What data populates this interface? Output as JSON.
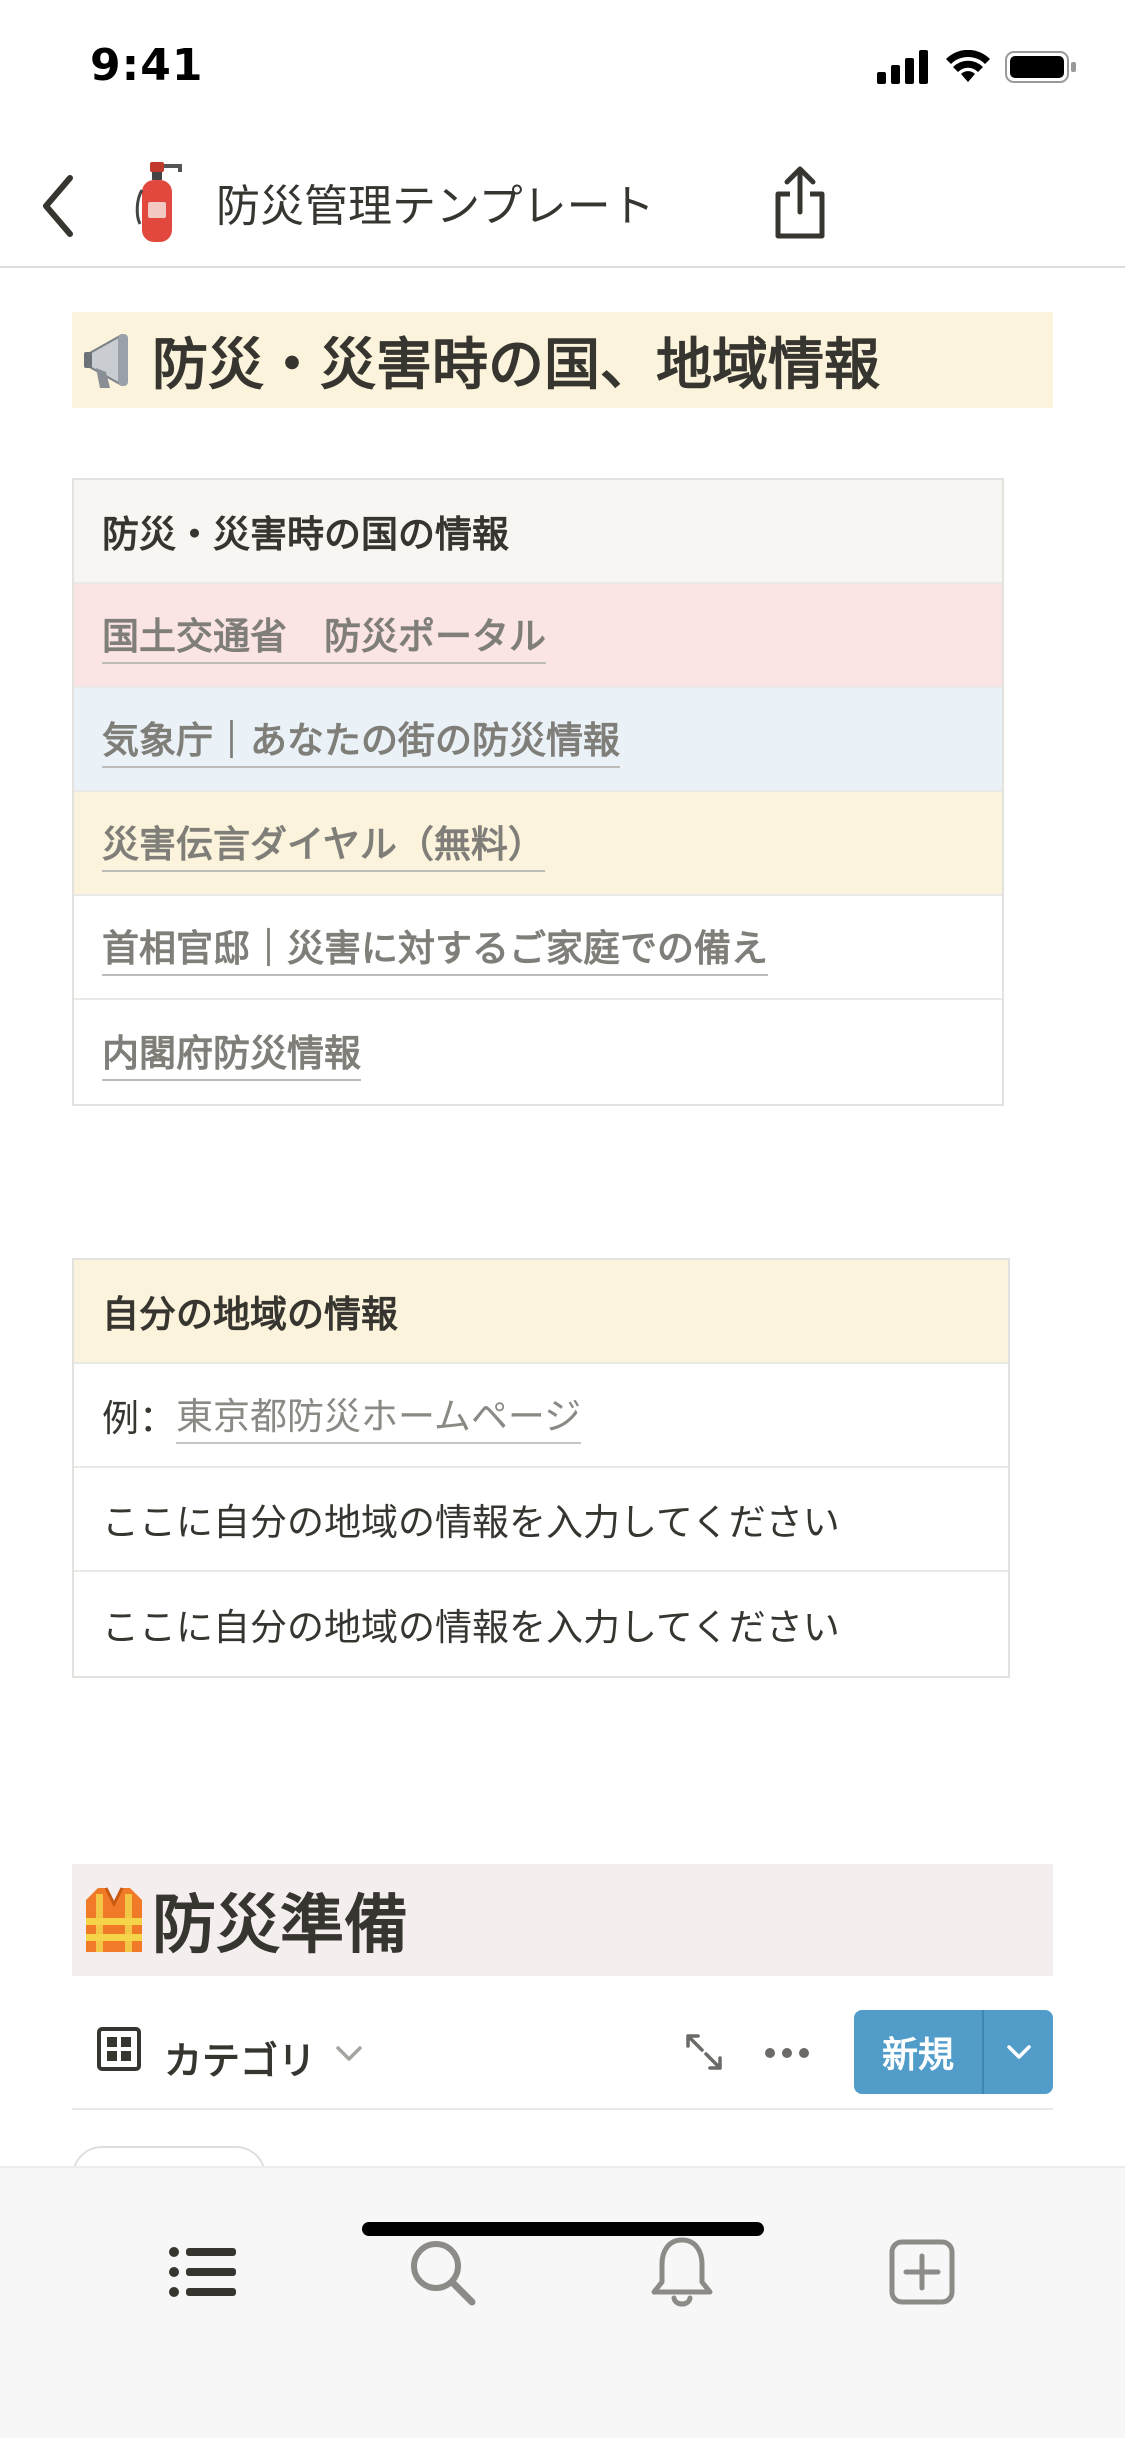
{
  "status_bar": {
    "time": "9:41"
  },
  "nav": {
    "title": "防災管理テンプレート"
  },
  "section1": {
    "heading": "防災・災害時の国、地域情報",
    "national_table": {
      "header": "防災・災害時の国の情報",
      "rows": [
        {
          "label": "国土交通省　防災ポータル",
          "color": "#fbe4e4"
        },
        {
          "label": "気象庁｜あなたの街の防災情報",
          "color": "#eaf2f8"
        },
        {
          "label": "災害伝言ダイヤル（無料）",
          "color": "#fbf3db"
        },
        {
          "label": "首相官邸｜災害に対するご家庭での備え",
          "color": "#ffffff"
        },
        {
          "label": "内閣府防災情報",
          "color": "#ffffff"
        }
      ]
    },
    "local_table": {
      "header": "自分の地域の情報",
      "example_prefix": "例：",
      "example_link": "東京都防災ホームページ",
      "rows": [
        "ここに自分の地域の情報を入力してください",
        "ここに自分の地域の情報を入力してください"
      ]
    }
  },
  "section2": {
    "heading": "防災準備",
    "toolbar": {
      "view_label": "カテゴリ",
      "new_button": "新規"
    }
  },
  "colors": {
    "accent": "#529cca",
    "callout_yellow": "#fbf3db",
    "callout_red": "#fbe4e4",
    "callout_blue": "#eaf2f8"
  },
  "tab_bar": {
    "icons": [
      "list-icon",
      "search-icon",
      "bell-icon",
      "add-page-icon"
    ]
  }
}
